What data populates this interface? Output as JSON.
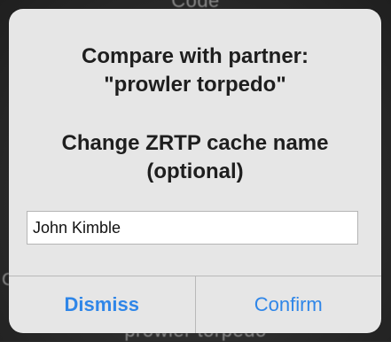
{
  "background": {
    "top_partial_text": "Code",
    "left_partial_text": "Ca",
    "bottom_partial_text": "prowler  torpedo"
  },
  "alert": {
    "title_line1": "Compare with partner:",
    "title_line2": "\"prowler  torpedo\"",
    "message_line1": "Change ZRTP cache name",
    "message_line2": "(optional)",
    "input_value": "John Kimble",
    "dismiss_label": "Dismiss",
    "confirm_label": "Confirm"
  },
  "colors": {
    "alert_bg": "#e6e6e6",
    "button_text": "#2f86e8",
    "text_primary": "#1e1e1e"
  }
}
